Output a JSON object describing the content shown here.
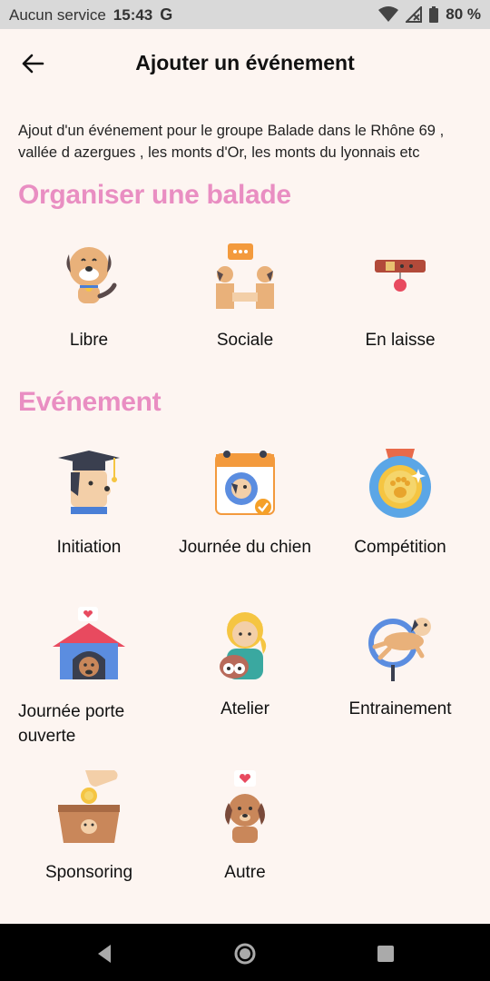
{
  "status_bar": {
    "carrier": "Aucun service",
    "time": "15:43",
    "google": "G",
    "battery": "80 %"
  },
  "header": {
    "title": "Ajouter un événement"
  },
  "description": "Ajout d'un événement pour le groupe Balade dans le Rhône 69 , vallée d azergues , les monts d'Or,  les monts du lyonnais etc",
  "sections": [
    {
      "title": "Organiser une balade",
      "items": [
        {
          "label": "Libre",
          "icon": "happy-dog-icon"
        },
        {
          "label": "Sociale",
          "icon": "social-dogs-icon"
        },
        {
          "label": "En laisse",
          "icon": "dog-collar-icon"
        }
      ]
    },
    {
      "title": "Evénement",
      "items": [
        {
          "label": "Initiation",
          "icon": "graduation-dog-icon"
        },
        {
          "label": "Journée du chien",
          "icon": "calendar-dog-icon"
        },
        {
          "label": "Compétition",
          "icon": "medal-icon"
        },
        {
          "label": "Journée porte ouverte",
          "icon": "dog-house-icon"
        },
        {
          "label": "Atelier",
          "icon": "girl-with-dog-icon"
        },
        {
          "label": "Entrainement",
          "icon": "dog-jumping-hoop-icon"
        },
        {
          "label": "Sponsoring",
          "icon": "donation-box-icon"
        },
        {
          "label": "Autre",
          "icon": "dog-heart-icon"
        }
      ]
    }
  ],
  "colors": {
    "background": "#fdf5f1",
    "section_title": "#e98ec2",
    "status_bar": "#d9d9d9",
    "nav_bar": "#000000"
  }
}
